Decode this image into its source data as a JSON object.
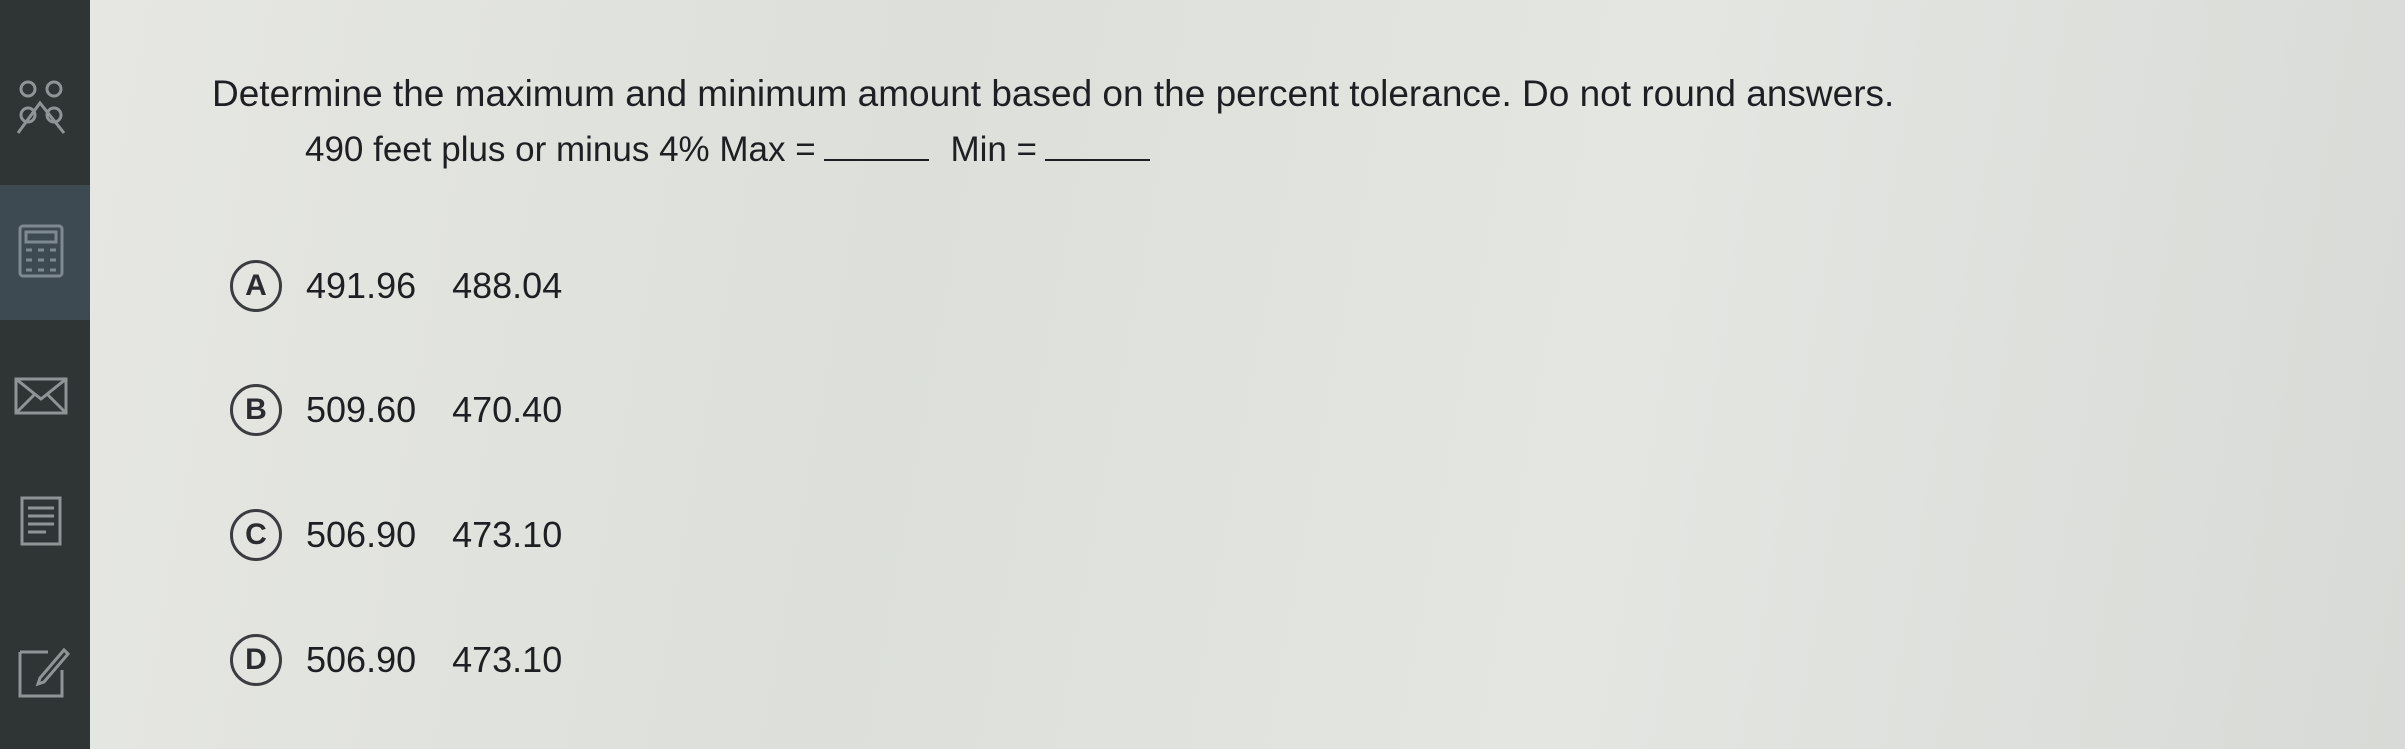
{
  "sidebar": {
    "icons": [
      "collaborate-icon",
      "calculator-icon",
      "mail-icon",
      "notes-icon",
      "edit-icon"
    ]
  },
  "question": {
    "prompt": "Determine the maximum and minimum amount based on the percent tolerance. Do not round answers.",
    "stem": "490 feet plus or minus 4%",
    "max_label": "Max =",
    "min_label": "Min ="
  },
  "options": [
    {
      "letter": "A",
      "max": "491.96",
      "min": "488.04"
    },
    {
      "letter": "B",
      "max": "509.60",
      "min": "470.40"
    },
    {
      "letter": "C",
      "max": "506.90",
      "min": "473.10"
    },
    {
      "letter": "D",
      "max": "506.90",
      "min": "473.10"
    }
  ]
}
